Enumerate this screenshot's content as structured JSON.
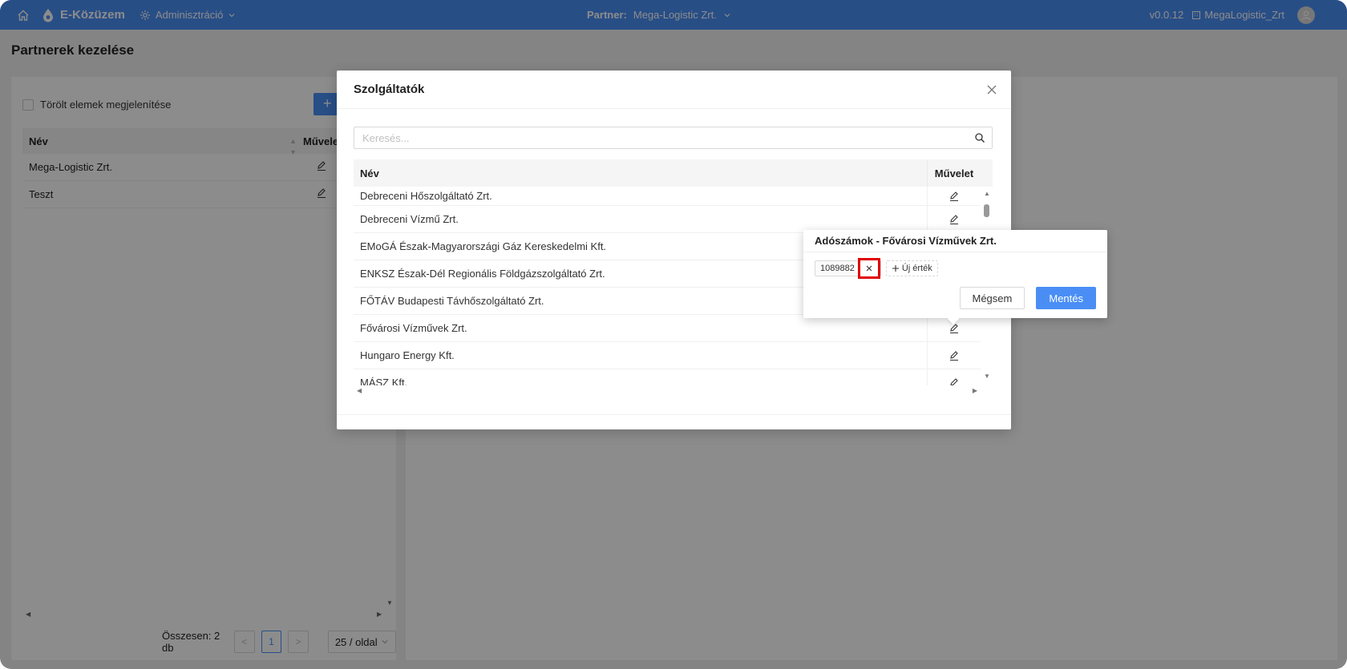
{
  "header": {
    "app_name": "E-Közüzem",
    "admin_menu": "Adminisztráció",
    "partner_label": "Partner:",
    "partner_value": "Mega-Logistic Zrt.",
    "version": "v0.0.12",
    "user": "MegaLogistic_Zrt"
  },
  "page": {
    "title": "Partnerek kezelése",
    "show_deleted_label": "Törölt elemek megjelenítése",
    "add_button": "+",
    "table": {
      "col_name": "Név",
      "col_action": "Művelet",
      "rows": [
        "Mega-Logistic Zrt.",
        "Teszt"
      ]
    },
    "pagination": {
      "total": "Összesen: 2 db",
      "current_page": "1",
      "page_size": "25 / oldal"
    }
  },
  "modal": {
    "title": "Szolgáltatók",
    "search_placeholder": "Keresés...",
    "table": {
      "col_name": "Név",
      "col_action": "Művelet",
      "rows": [
        "Debreceni Hőszolgáltató Zrt.",
        "Debreceni Vízmű Zrt.",
        "EMoGÁ Észak-Magyarországi Gáz Kereskedelmi Kft.",
        "ENKSZ Észak-Dél Regionális Földgázszolgáltató Zrt.",
        "FŐTÁV Budapesti Távhőszolgáltató Zrt.",
        "Fővárosi Vízművek Zrt.",
        "Hungaro Energy Kft.",
        "MÁSZ Kft."
      ]
    }
  },
  "popover": {
    "title": "Adószámok - Fővárosi Vízművek Zrt.",
    "tag_value": "1089882",
    "new_value_label": "Új érték",
    "cancel_label": "Mégsem",
    "save_label": "Mentés"
  }
}
